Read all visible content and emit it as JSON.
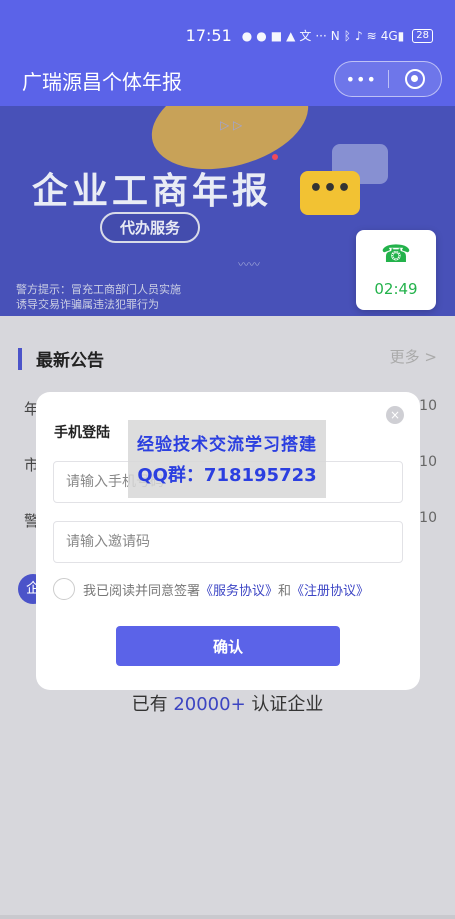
{
  "status_bar": {
    "time": "17:51",
    "icons": [
      "wechat-icon",
      "wechat-icon",
      "search-app-icon",
      "qq-icon",
      "translate-icon",
      "more-icon",
      "nfc-icon",
      "bluetooth-icon",
      "mic-icon",
      "wifi-icon",
      "signal-icon"
    ],
    "extra": "···",
    "network": "4G",
    "battery": "28"
  },
  "header": {
    "title": "广瑞源昌个体年报",
    "more_label": "•••",
    "colors": {
      "bar": "#5b63e8"
    }
  },
  "banner": {
    "title": "企业工商年报",
    "pill": "代办服务",
    "warning_line1": "警方提示：冒充工商部门人员实施",
    "warning_line2": "诱导交易诈骗属违法犯罪行为",
    "chat_dots": "•••"
  },
  "call_badge": {
    "timer": "02:49",
    "phone_icon": "☎"
  },
  "notice": {
    "title": "最新公告",
    "more": "更多 >",
    "rows": [
      {
        "frag": "年",
        "date": "10"
      },
      {
        "frag": "市",
        "date": "10"
      },
      {
        "frag": "警",
        "date": "10"
      }
    ]
  },
  "certified": {
    "prefix": "已有 ",
    "number": "20000+",
    "suffix": " 认证企业"
  },
  "circle_fragment": "企",
  "dialog": {
    "title": "手机登陆",
    "close": "×",
    "phone_placeholder": "请输入手机号码",
    "invite_placeholder": "请输入邀请码",
    "agree_prefix": "我已阅读并同意签署",
    "service_link": "《服务协议》",
    "and": "和",
    "register_link": "《注册协议》",
    "confirm": "确认"
  },
  "watermark": {
    "line1": "经验技术交流学习搭建",
    "line2": "QQ群：718195723"
  }
}
